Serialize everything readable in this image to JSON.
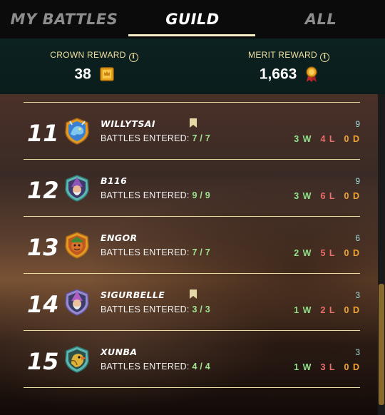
{
  "tabs": [
    {
      "label": "MY BATTLES",
      "active": false
    },
    {
      "label": "GUILD",
      "active": true
    },
    {
      "label": "ALL",
      "active": false
    }
  ],
  "rewards": {
    "crown": {
      "label": "CROWN REWARD",
      "value": "38",
      "icon": "crown-token-icon"
    },
    "merit": {
      "label": "MERIT REWARD",
      "value": "1,663",
      "icon": "merit-medal-icon"
    },
    "info_icon": "info-icon"
  },
  "entered_label": "BATTLES ENTERED:",
  "rows": [
    {
      "rank": "11",
      "name": "WILLYTSAI",
      "avatar": "dragon-avatar",
      "bookmarked": true,
      "entered": "7 / 7",
      "total": "9",
      "wins": "3 W",
      "losses": "4 L",
      "draws": "0 D"
    },
    {
      "rank": "12",
      "name": "B116",
      "avatar": "wizard-avatar",
      "bookmarked": false,
      "entered": "9 / 9",
      "total": "9",
      "wins": "3 W",
      "losses": "6 L",
      "draws": "0 D"
    },
    {
      "rank": "13",
      "name": "ENGOR",
      "avatar": "goblin-avatar",
      "bookmarked": false,
      "entered": "7 / 7",
      "total": "6",
      "wins": "2 W",
      "losses": "5 L",
      "draws": "0 D"
    },
    {
      "rank": "14",
      "name": "SIGURBELLE",
      "avatar": "wizard-avatar",
      "bookmarked": true,
      "entered": "3 / 3",
      "total": "3",
      "wins": "1 W",
      "losses": "2 L",
      "draws": "0 D"
    },
    {
      "rank": "15",
      "name": "XUNBA",
      "avatar": "bird-avatar",
      "bookmarked": false,
      "entered": "4 / 4",
      "total": "3",
      "wins": "1 W",
      "losses": "3 L",
      "draws": "0 D"
    }
  ],
  "colors": {
    "accent": "#f3ecc6",
    "wins": "#8fe08a",
    "losses": "#ee6e6e",
    "draws": "#f0a534",
    "total": "#9edcdc"
  }
}
